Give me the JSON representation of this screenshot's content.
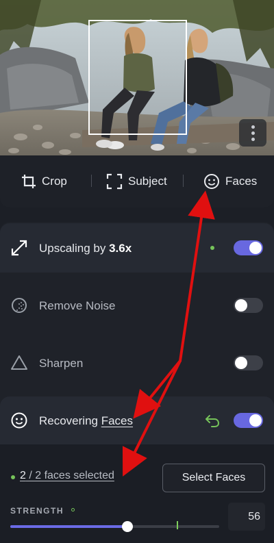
{
  "tools": {
    "crop_label": "Crop",
    "subject_label": "Subject",
    "faces_label": "Faces"
  },
  "adjustments": {
    "upscale": {
      "label_prefix": "Upscaling by ",
      "value": "3.6x",
      "enabled": true
    },
    "remove_noise": {
      "label": "Remove Noise",
      "enabled": false
    },
    "sharpen": {
      "label": "Sharpen",
      "enabled": false
    },
    "recover_faces": {
      "label_prefix": "Recovering ",
      "link_label": "Faces",
      "enabled": true
    }
  },
  "faces_panel": {
    "selected_count": "2",
    "selected_suffix": " / 2 faces selected",
    "select_button_label": "Select Faces",
    "strength_label": "STRENGTH",
    "strength_value": 56,
    "strength_display": "56",
    "strength_default": 80
  },
  "colors": {
    "accent": "#6868e0",
    "status_green": "#76c35a",
    "annotation_red": "#e01010"
  }
}
